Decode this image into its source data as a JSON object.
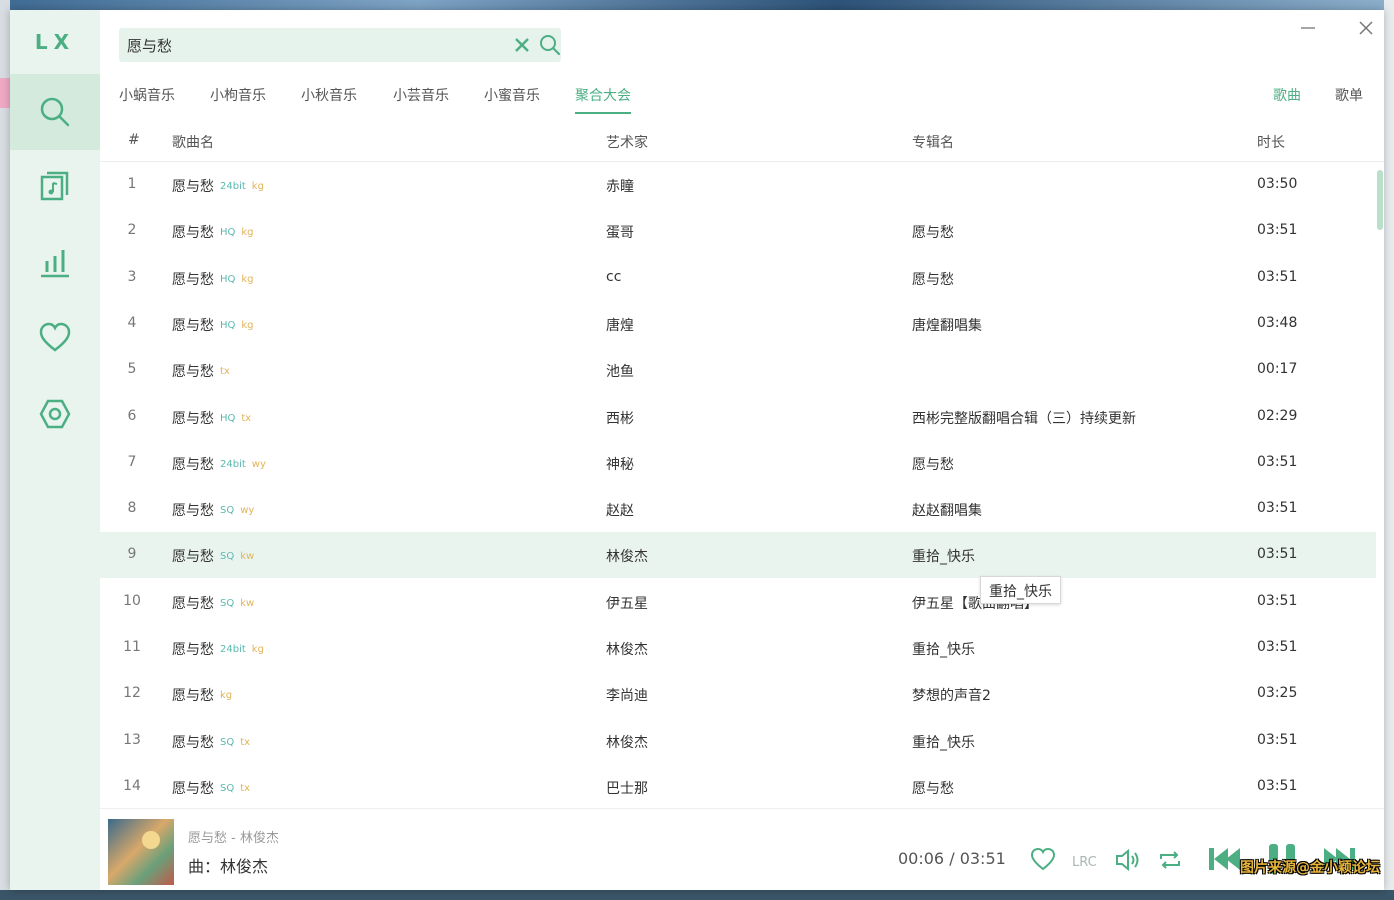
{
  "app": {
    "logo": "LX"
  },
  "sidebar": {
    "items": [
      {
        "icon": "search-icon",
        "active": true
      },
      {
        "icon": "song-list-icon",
        "active": false
      },
      {
        "icon": "leaderboard-icon",
        "active": false
      },
      {
        "icon": "heart-icon",
        "active": false
      },
      {
        "icon": "settings-icon",
        "active": false
      }
    ]
  },
  "search": {
    "value": "愿与愁"
  },
  "sources": [
    "小蜗音乐",
    "小枸音乐",
    "小秋音乐",
    "小芸音乐",
    "小蜜音乐",
    "聚合大会"
  ],
  "active_source": "聚合大会",
  "types": [
    "歌曲",
    "歌单"
  ],
  "active_type": "歌曲",
  "table": {
    "headers": {
      "index": "#",
      "name": "歌曲名",
      "artist": "艺术家",
      "album": "专辑名",
      "duration": "时长"
    },
    "rows": [
      {
        "index": "1",
        "name": "愿与愁",
        "quality": "24bit",
        "source": "kg",
        "artist": "赤瞳",
        "album": "",
        "duration": "03:50"
      },
      {
        "index": "2",
        "name": "愿与愁",
        "quality": "HQ",
        "source": "kg",
        "artist": "蛋哥",
        "album": "愿与愁",
        "duration": "03:51"
      },
      {
        "index": "3",
        "name": "愿与愁",
        "quality": "HQ",
        "source": "kg",
        "artist": "cc",
        "album": "愿与愁",
        "duration": "03:51"
      },
      {
        "index": "4",
        "name": "愿与愁",
        "quality": "HQ",
        "source": "kg",
        "artist": "唐煌",
        "album": "唐煌翻唱集",
        "duration": "03:48"
      },
      {
        "index": "5",
        "name": "愿与愁",
        "quality": "",
        "source": "tx",
        "artist": "池鱼",
        "album": "",
        "duration": "00:17"
      },
      {
        "index": "6",
        "name": "愿与愁",
        "quality": "HQ",
        "source": "tx",
        "artist": "西彬",
        "album": "西彬完整版翻唱合辑（三）持续更新",
        "duration": "02:29"
      },
      {
        "index": "7",
        "name": "愿与愁",
        "quality": "24bit",
        "source": "wy",
        "artist": "神秘",
        "album": "愿与愁",
        "duration": "03:51"
      },
      {
        "index": "8",
        "name": "愿与愁",
        "quality": "SQ",
        "source": "wy",
        "artist": "赵赵",
        "album": "赵赵翻唱集",
        "duration": "03:51"
      },
      {
        "index": "9",
        "name": "愿与愁",
        "quality": "SQ",
        "source": "kw",
        "artist": "林俊杰",
        "album": "重拾_快乐",
        "duration": "03:51"
      },
      {
        "index": "10",
        "name": "愿与愁",
        "quality": "SQ",
        "source": "kw",
        "artist": "伊五星",
        "album": "伊五星【歌曲翻唱】",
        "duration": "03:51"
      },
      {
        "index": "11",
        "name": "愿与愁",
        "quality": "24bit",
        "source": "kg",
        "artist": "林俊杰",
        "album": "重拾_快乐",
        "duration": "03:51"
      },
      {
        "index": "12",
        "name": "愿与愁",
        "quality": "",
        "source": "kg",
        "artist": "李尚迪",
        "album": "梦想的声音2",
        "duration": "03:25"
      },
      {
        "index": "13",
        "name": "愿与愁",
        "quality": "SQ",
        "source": "tx",
        "artist": "林俊杰",
        "album": "重拾_快乐",
        "duration": "03:51"
      },
      {
        "index": "14",
        "name": "愿与愁",
        "quality": "SQ",
        "source": "tx",
        "artist": "巴士那",
        "album": "愿与愁",
        "duration": "03:51"
      }
    ]
  },
  "tooltip": "重拾_快乐",
  "player": {
    "title": "愿与愁 - 林俊杰",
    "lyric": "曲：林俊杰",
    "current_time": "00:06",
    "separator": "/",
    "total_time": "03:51",
    "controls": [
      "heart-icon",
      "lyric-icon",
      "volume-icon",
      "repeat-icon",
      "previous-icon",
      "pause-icon",
      "next-icon"
    ]
  },
  "watermark": "图片来源@金小颖论坛",
  "colors": {
    "accent": "#4caf84",
    "sidebar_bg": "#e9f4ee",
    "quality_tag": "#5ab9b0",
    "source_tag": "#e2b35a"
  }
}
